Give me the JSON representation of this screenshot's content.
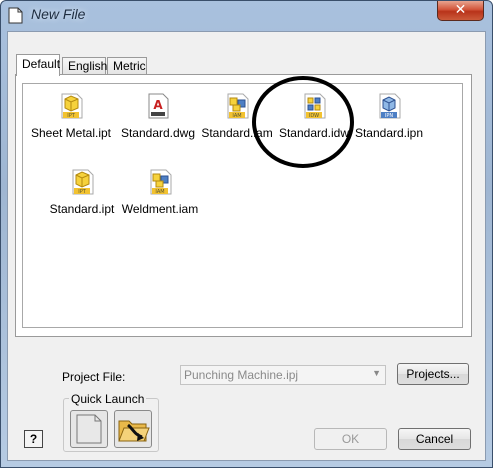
{
  "window": {
    "title": "New File",
    "close_label": "✕"
  },
  "tabs": [
    {
      "label": "Default"
    },
    {
      "label": "English"
    },
    {
      "label": "Metric"
    }
  ],
  "files": [
    {
      "name": "Sheet Metal.ipt",
      "type": "IPT",
      "icon": "part-icon"
    },
    {
      "name": "Standard.dwg",
      "type": "DWG",
      "icon": "autocad-drawing-icon"
    },
    {
      "name": "Standard.iam",
      "type": "IAM",
      "icon": "assembly-icon"
    },
    {
      "name": "Standard.idw",
      "type": "IDW",
      "icon": "drawing-icon"
    },
    {
      "name": "Standard.ipn",
      "type": "IPN",
      "icon": "presentation-icon"
    },
    {
      "name": "Standard.ipt",
      "type": "IPT",
      "icon": "part-icon"
    },
    {
      "name": "Weldment.iam",
      "type": "IAM",
      "icon": "assembly-icon"
    }
  ],
  "project": {
    "label": "Project File:",
    "value": "Punching Machine.ipj",
    "projects_button": "Projects..."
  },
  "quick_launch": {
    "label": "Quick Launch"
  },
  "buttons": {
    "ok": "OK",
    "cancel": "Cancel",
    "help": "?"
  },
  "colors": {
    "accent_yellow": "#f2c230",
    "accent_blue": "#4d7fc4",
    "annotation": "#000000"
  }
}
